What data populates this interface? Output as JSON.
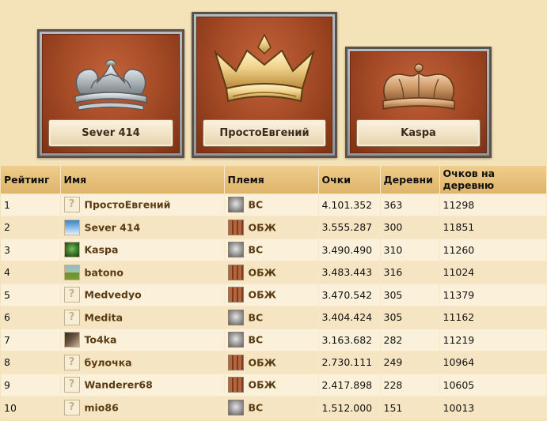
{
  "podium": {
    "first": {
      "name": "ПростоЕвгений"
    },
    "second": {
      "name": "Sever 414"
    },
    "third": {
      "name": "Kaspa"
    }
  },
  "table": {
    "headers": {
      "rank": "Рейтинг",
      "name": "Имя",
      "tribe": "Племя",
      "points": "Очки",
      "villages": "Деревни",
      "per_village": "Очков на деревню"
    },
    "rows": [
      {
        "rank": "1",
        "name": "ПростоЕвгений",
        "avatar": "unknown",
        "tribe": "ВС",
        "tribe_icon": "gray",
        "points": "4.101.352",
        "villages": "363",
        "per_village": "11298"
      },
      {
        "rank": "2",
        "name": "Sever 414",
        "avatar": "sky",
        "tribe": "ОБЖ",
        "tribe_icon": "orange",
        "points": "3.555.287",
        "villages": "300",
        "per_village": "11851"
      },
      {
        "rank": "3",
        "name": "Kaspa",
        "avatar": "green",
        "tribe": "ВС",
        "tribe_icon": "gray",
        "points": "3.490.490",
        "villages": "310",
        "per_village": "11260"
      },
      {
        "rank": "4",
        "name": "batono",
        "avatar": "field",
        "tribe": "ОБЖ",
        "tribe_icon": "orange",
        "points": "3.483.443",
        "villages": "316",
        "per_village": "11024"
      },
      {
        "rank": "5",
        "name": "Medvedyo",
        "avatar": "unknown",
        "tribe": "ОБЖ",
        "tribe_icon": "orange",
        "points": "3.470.542",
        "villages": "305",
        "per_village": "11379"
      },
      {
        "rank": "6",
        "name": "Medita",
        "avatar": "unknown",
        "tribe": "ВС",
        "tribe_icon": "gray",
        "points": "3.404.424",
        "villages": "305",
        "per_village": "11162"
      },
      {
        "rank": "7",
        "name": "To4ka",
        "avatar": "dark",
        "tribe": "ВС",
        "tribe_icon": "gray",
        "points": "3.163.682",
        "villages": "282",
        "per_village": "11219"
      },
      {
        "rank": "8",
        "name": "булочка",
        "avatar": "unknown",
        "tribe": "ОБЖ",
        "tribe_icon": "orange",
        "points": "2.730.111",
        "villages": "249",
        "per_village": "10964"
      },
      {
        "rank": "9",
        "name": "Wanderer68",
        "avatar": "unknown",
        "tribe": "ОБЖ",
        "tribe_icon": "orange",
        "points": "2.417.898",
        "villages": "228",
        "per_village": "10605"
      },
      {
        "rank": "10",
        "name": "mio86",
        "avatar": "unknown",
        "tribe": "ВС",
        "tribe_icon": "gray",
        "points": "1.512.000",
        "villages": "151",
        "per_village": "10013"
      }
    ]
  }
}
